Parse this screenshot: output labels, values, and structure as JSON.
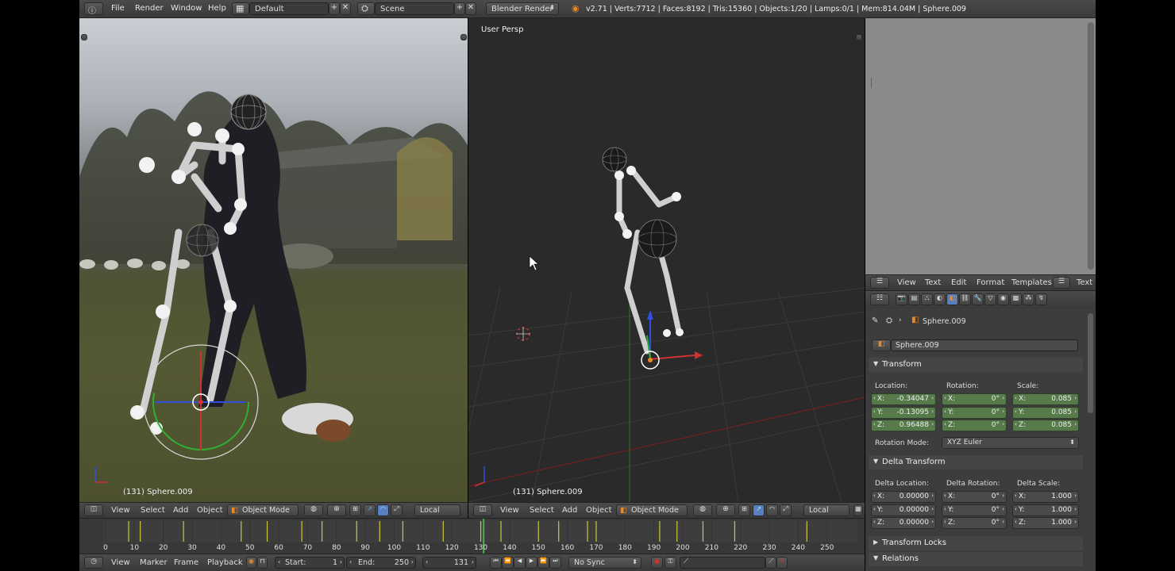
{
  "topbar": {
    "menu": [
      "File",
      "Render",
      "Window",
      "Help"
    ],
    "screen_layout": "Default",
    "scene": "Scene",
    "render_engine": "Blender Render",
    "stats": "v2.71 | Verts:7712 | Faces:8192 | Tris:15360 | Objects:1/20 | Lamps:0/1 | Mem:814.04M | Sphere.009"
  },
  "viewport_left": {
    "object_label": "(131) Sphere.009"
  },
  "viewport_right": {
    "view_label": "User Persp",
    "object_label": "(131) Sphere.009"
  },
  "view_header": {
    "menu": [
      "View",
      "Select",
      "Add",
      "Object"
    ],
    "mode": "Object Mode",
    "pivot": "Local"
  },
  "timeline": {
    "ticks": [
      "0",
      "10",
      "20",
      "30",
      "40",
      "50",
      "60",
      "70",
      "80",
      "90",
      "100",
      "110",
      "120",
      "130",
      "140",
      "150",
      "160",
      "170",
      "180",
      "190",
      "200",
      "210",
      "220",
      "230",
      "240",
      "250"
    ],
    "current_frame": 131,
    "keyframes": [
      8,
      12,
      27,
      47,
      56,
      68,
      75,
      87,
      95,
      103,
      117,
      130,
      137,
      150,
      157,
      167,
      170,
      192,
      198,
      207,
      218,
      243
    ],
    "header_menu": [
      "View",
      "Marker",
      "Frame",
      "Playback"
    ],
    "start_label": "Start:",
    "start_value": "1",
    "end_label": "End:",
    "end_value": "250",
    "frame_value": "131",
    "sync": "No Sync"
  },
  "text_editor_header": {
    "menu": [
      "View",
      "Text",
      "Edit",
      "Format",
      "Templates"
    ],
    "mode_label": "Text"
  },
  "properties": {
    "breadcrumb": "Sphere.009",
    "object_name": "Sphere.009",
    "transform_title": "Transform",
    "location_label": "Location:",
    "rotation_label": "Rotation:",
    "scale_label": "Scale:",
    "location": [
      {
        "axis": "X:",
        "value": "-0.34047"
      },
      {
        "axis": "Y:",
        "value": "-0.13095"
      },
      {
        "axis": "Z:",
        "value": "0.96488"
      }
    ],
    "rotation": [
      {
        "axis": "X:",
        "value": "0°"
      },
      {
        "axis": "Y:",
        "value": "0°"
      },
      {
        "axis": "Z:",
        "value": "0°"
      }
    ],
    "scale": [
      {
        "axis": "X:",
        "value": "0.085"
      },
      {
        "axis": "Y:",
        "value": "0.085"
      },
      {
        "axis": "Z:",
        "value": "0.085"
      }
    ],
    "rotation_mode_label": "Rotation Mode:",
    "rotation_mode": "XYZ Euler",
    "delta_title": "Delta Transform",
    "delta_location_label": "Delta Location:",
    "delta_rotation_label": "Delta Rotation:",
    "delta_scale_label": "Delta Scale:",
    "delta_location": [
      {
        "axis": "X:",
        "value": "0.00000"
      },
      {
        "axis": "Y:",
        "value": "0.00000"
      },
      {
        "axis": "Z:",
        "value": "0.00000"
      }
    ],
    "delta_rotation": [
      {
        "axis": "X:",
        "value": "0°"
      },
      {
        "axis": "Y:",
        "value": "0°"
      },
      {
        "axis": "Z:",
        "value": "0°"
      }
    ],
    "delta_scale": [
      {
        "axis": "X:",
        "value": "1.000"
      },
      {
        "axis": "Y:",
        "value": "1.000"
      },
      {
        "axis": "Z:",
        "value": "1.000"
      }
    ],
    "transform_locks_title": "Transform Locks",
    "relations_title": "Relations"
  },
  "colors": {
    "accent_orange": "#e88a2a",
    "field_green": "#567a4a",
    "axis_red": "#d03030",
    "axis_green": "#30b030",
    "axis_blue": "#3050e0"
  }
}
